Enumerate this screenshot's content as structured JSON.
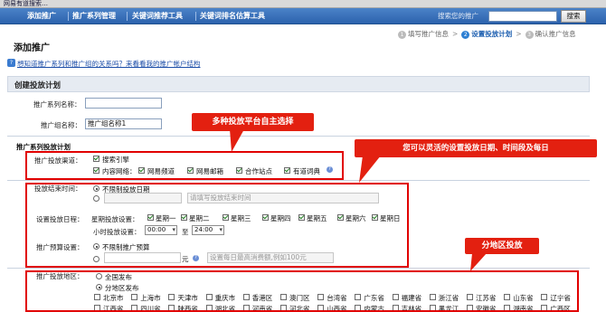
{
  "browser": {
    "title": "网易有道搜索…"
  },
  "nav": {
    "items": [
      "添加推广",
      "推广系列管理",
      "关键词推荐工具",
      "关键词排名估算工具"
    ],
    "search_label": "搜索您的推广",
    "search_button": "搜索"
  },
  "steps": {
    "items": [
      {
        "num": "1",
        "label": "填写推广信息",
        "active": false
      },
      {
        "num": "2",
        "label": "设置投放计划",
        "active": true
      },
      {
        "num": "3",
        "label": "确认推广信息",
        "active": false
      }
    ]
  },
  "page": {
    "title": "添加推广",
    "help_link": "想知道推广系列和推广组的关系吗？来看看我的推广帐户结构",
    "section_title": "创建投放计划"
  },
  "form": {
    "series_name_label": "推广系列名称：",
    "series_name_value": "",
    "group_name_label": "推广组名称：",
    "group_name_value": "推广组名称1",
    "plan_title": "推广系列投放计划",
    "channel_label": "推广投放渠道：",
    "channel_search": "搜索引擎",
    "channel_content": "内容网络：",
    "channel_sites": [
      "网易频道",
      "网易邮箱",
      "合作站点",
      "有道词典"
    ],
    "end_time_label": "投放结束时间：",
    "end_time_unlimited": "不限制投放日期",
    "end_time_placeholder": "请填写投放结束时间",
    "schedule_label": "设置投放日程：",
    "week_label": "星期投放设置：",
    "weekdays": [
      "星期一",
      "星期二",
      "星期三",
      "星期四",
      "星期五",
      "星期六",
      "星期日"
    ],
    "hour_label": "小时投放设置：",
    "hour_from": "00:00",
    "hour_to_word": "至",
    "hour_to": "24:00",
    "budget_label": "推广预算设置：",
    "budget_unlimited": "不限制推广预算",
    "budget_unit": "元",
    "budget_placeholder": "设置每日最高消费额,例如100元",
    "region_label": "推广投放地区：",
    "region_all": "全国发布",
    "region_partial": "分地区发布",
    "regions_row1": [
      "北京市",
      "上海市",
      "天津市",
      "重庆市",
      "香港区",
      "澳门区",
      "台湾省",
      "广东省",
      "福建省",
      "浙江省",
      "江苏省",
      "山东省",
      "辽宁省"
    ],
    "regions_row2": [
      "江西省",
      "四川省",
      "陕西省",
      "湖北省",
      "河南省",
      "河北省",
      "山西省",
      "内蒙古",
      "吉林省",
      "黑龙江",
      "安徽省",
      "湖南省",
      "广西区"
    ]
  },
  "annotations": {
    "callout1": "多种投放平台自主选择",
    "callout2": "您可以灵活的设置投放日期、时间段及每日",
    "callout3": "分地区投放"
  },
  "colors": {
    "nav_bg": "#2c62ad",
    "callout": "#e32010",
    "link": "#1c4ea8"
  }
}
